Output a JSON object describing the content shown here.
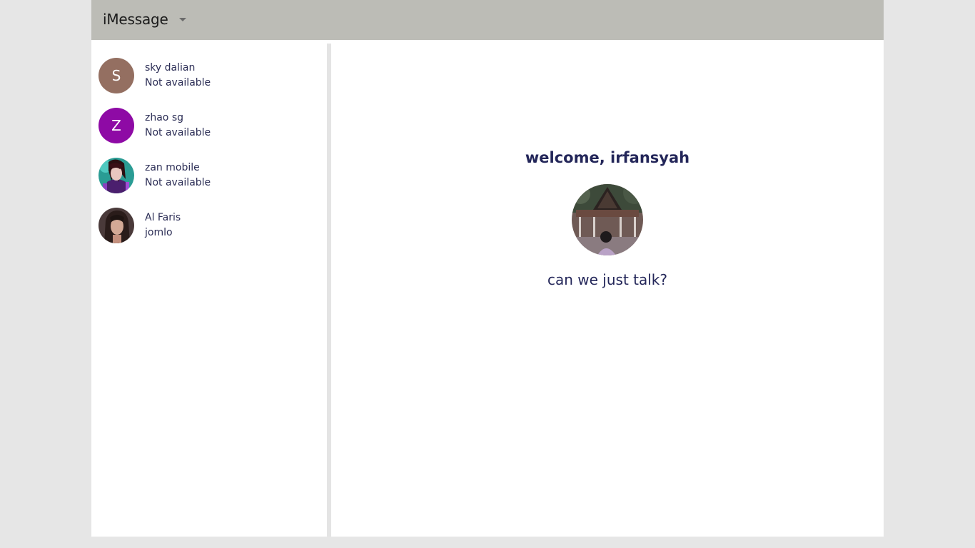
{
  "header": {
    "title": "iMessage"
  },
  "contacts": [
    {
      "name": "sky dalian",
      "status": "Not available",
      "initial": "S",
      "avatar_color": "#946f61"
    },
    {
      "name": "zhao sg",
      "status": "Not available",
      "initial": "Z",
      "avatar_color": "#8e0aa5"
    },
    {
      "name": "zan mobile",
      "status": "Not available"
    },
    {
      "name": "Al Faris",
      "status": "jomlo"
    }
  ],
  "main": {
    "welcome": "welcome, irfansyah",
    "status_message": "can we just talk?"
  },
  "colors": {
    "header_bg": "#bcbcb6",
    "page_bg": "#e6e6e6",
    "text_primary": "#232659"
  }
}
